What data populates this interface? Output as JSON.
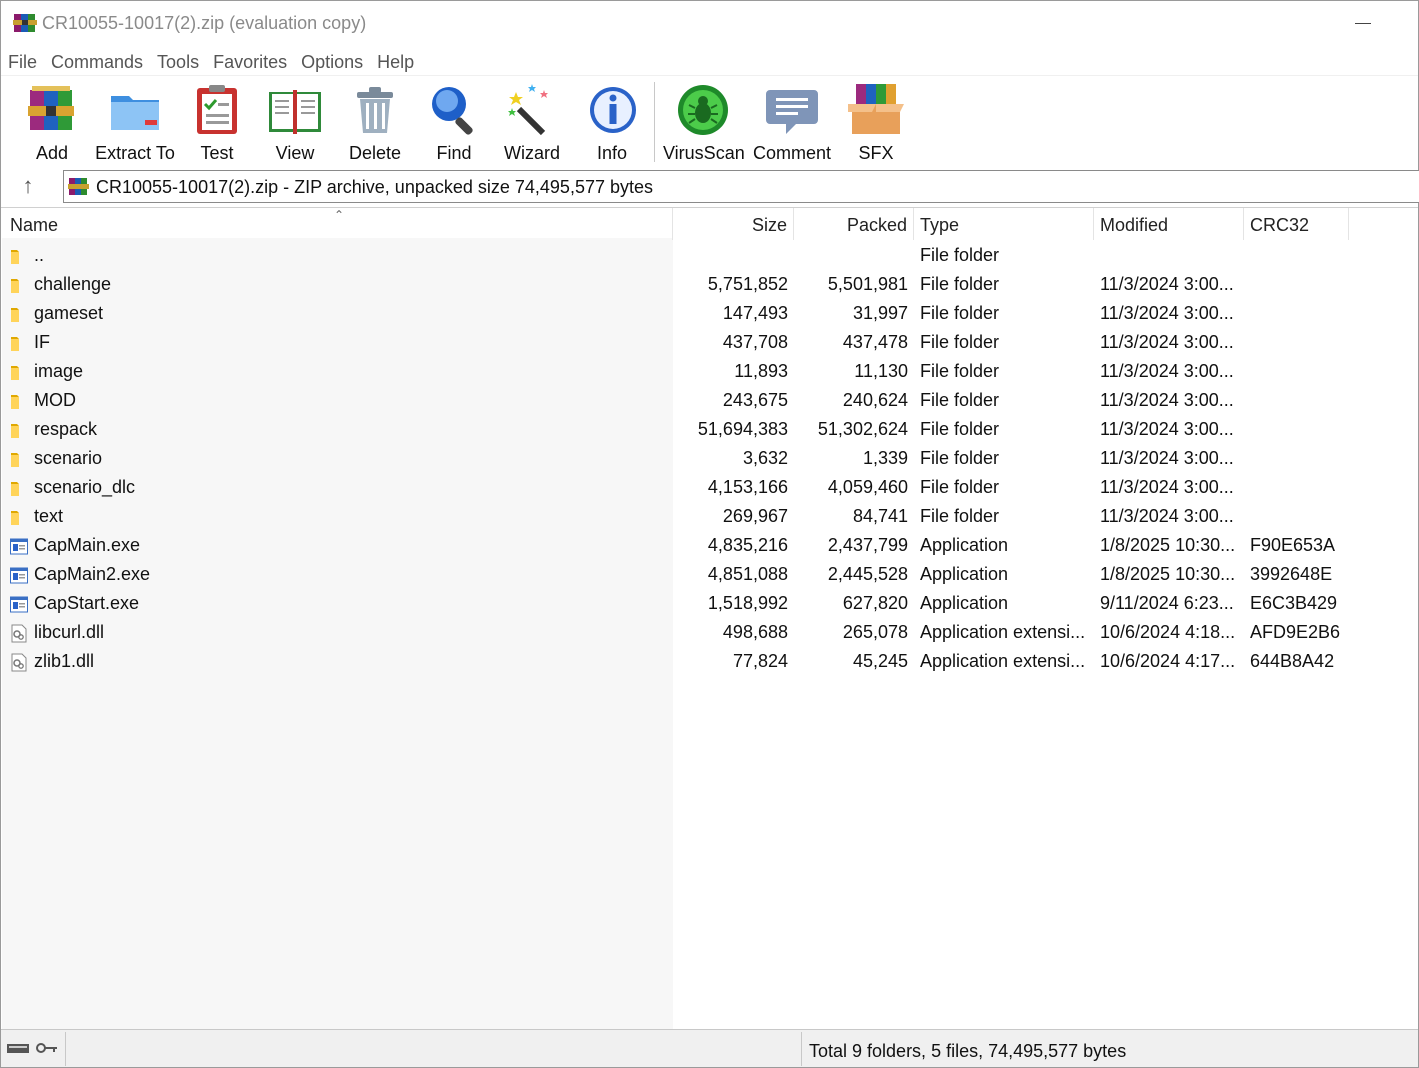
{
  "window": {
    "title": "CR10055-10017(2).zip (evaluation copy)"
  },
  "menu": [
    "File",
    "Commands",
    "Tools",
    "Favorites",
    "Options",
    "Help"
  ],
  "toolbar": {
    "add": "Add",
    "extract_to": "Extract To",
    "test": "Test",
    "view": "View",
    "delete": "Delete",
    "find": "Find",
    "wizard": "Wizard",
    "info": "Info",
    "virusscan": "VirusScan",
    "comment": "Comment",
    "sfx": "SFX"
  },
  "address": {
    "text": "CR10055-10017(2).zip - ZIP archive, unpacked size 74,495,577 bytes"
  },
  "columns": {
    "name": "Name",
    "size": "Size",
    "packed": "Packed",
    "type": "Type",
    "modified": "Modified",
    "crc": "CRC32"
  },
  "files": [
    {
      "name": "..",
      "size": "",
      "packed": "",
      "type": "File folder",
      "modified": "",
      "crc": "",
      "icon": "folder-icon"
    },
    {
      "name": "challenge",
      "size": "5,751,852",
      "packed": "5,501,981",
      "type": "File folder",
      "modified": "11/3/2024 3:00...",
      "crc": "",
      "icon": "folder-icon"
    },
    {
      "name": "gameset",
      "size": "147,493",
      "packed": "31,997",
      "type": "File folder",
      "modified": "11/3/2024 3:00...",
      "crc": "",
      "icon": "folder-icon"
    },
    {
      "name": "IF",
      "size": "437,708",
      "packed": "437,478",
      "type": "File folder",
      "modified": "11/3/2024 3:00...",
      "crc": "",
      "icon": "folder-icon"
    },
    {
      "name": "image",
      "size": "11,893",
      "packed": "11,130",
      "type": "File folder",
      "modified": "11/3/2024 3:00...",
      "crc": "",
      "icon": "folder-icon"
    },
    {
      "name": "MOD",
      "size": "243,675",
      "packed": "240,624",
      "type": "File folder",
      "modified": "11/3/2024 3:00...",
      "crc": "",
      "icon": "folder-icon"
    },
    {
      "name": "respack",
      "size": "51,694,383",
      "packed": "51,302,624",
      "type": "File folder",
      "modified": "11/3/2024 3:00...",
      "crc": "",
      "icon": "folder-icon"
    },
    {
      "name": "scenario",
      "size": "3,632",
      "packed": "1,339",
      "type": "File folder",
      "modified": "11/3/2024 3:00...",
      "crc": "",
      "icon": "folder-icon"
    },
    {
      "name": "scenario_dlc",
      "size": "4,153,166",
      "packed": "4,059,460",
      "type": "File folder",
      "modified": "11/3/2024 3:00...",
      "crc": "",
      "icon": "folder-icon"
    },
    {
      "name": "text",
      "size": "269,967",
      "packed": "84,741",
      "type": "File folder",
      "modified": "11/3/2024 3:00...",
      "crc": "",
      "icon": "folder-icon"
    },
    {
      "name": "CapMain.exe",
      "size": "4,835,216",
      "packed": "2,437,799",
      "type": "Application",
      "modified": "1/8/2025 10:30...",
      "crc": "F90E653A",
      "icon": "exe-icon"
    },
    {
      "name": "CapMain2.exe",
      "size": "4,851,088",
      "packed": "2,445,528",
      "type": "Application",
      "modified": "1/8/2025 10:30...",
      "crc": "3992648E",
      "icon": "exe-icon"
    },
    {
      "name": "CapStart.exe",
      "size": "1,518,992",
      "packed": "627,820",
      "type": "Application",
      "modified": "9/11/2024 6:23...",
      "crc": "E6C3B429",
      "icon": "exe-icon"
    },
    {
      "name": "libcurl.dll",
      "size": "498,688",
      "packed": "265,078",
      "type": "Application extensi...",
      "modified": "10/6/2024 4:18...",
      "crc": "AFD9E2B6",
      "icon": "dll-icon"
    },
    {
      "name": "zlib1.dll",
      "size": "77,824",
      "packed": "45,245",
      "type": "Application extensi...",
      "modified": "10/6/2024 4:17...",
      "crc": "644B8A42",
      "icon": "dll-icon"
    }
  ],
  "status": {
    "text": "Total 9 folders, 5 files, 74,495,577 bytes"
  }
}
